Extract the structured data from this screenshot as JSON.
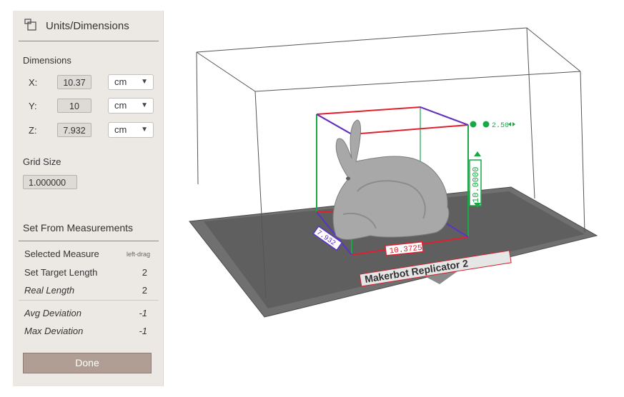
{
  "panel": {
    "title": "Units/Dimensions",
    "title_icon": "window-icon",
    "dimensions_heading": "Dimensions",
    "dimensions": [
      {
        "axis": "X:",
        "value": "10.37",
        "unit": "cm"
      },
      {
        "axis": "Y:",
        "value": "10",
        "unit": "cm"
      },
      {
        "axis": "Z:",
        "value": "7.932",
        "unit": "cm"
      }
    ],
    "grid_size_label": "Grid Size",
    "grid_size_value": "1.000000",
    "set_from_label": "Set From Measurements",
    "measurements": [
      {
        "label": "Selected Measure",
        "value": "left-drag"
      },
      {
        "label": "Set Target Length",
        "value": "2"
      },
      {
        "label": "Real Length",
        "value": "2"
      },
      {
        "label": "Avg Deviation",
        "value": "-1"
      },
      {
        "label": "Max Deviation",
        "value": "-1"
      }
    ],
    "done_label": "Done"
  },
  "viewport": {
    "printer_label": "Makerbot Replicator 2",
    "dim_x_label": "10.3725",
    "dim_y_label": "7.932",
    "dim_z_label": "10.0000",
    "grid_label": "2.50",
    "colors": {
      "x_axis": "#e0202f",
      "y_axis": "#5a33c9",
      "z_axis": "#1aa846",
      "plate": "#6e6e6e",
      "box": "#555555"
    }
  }
}
